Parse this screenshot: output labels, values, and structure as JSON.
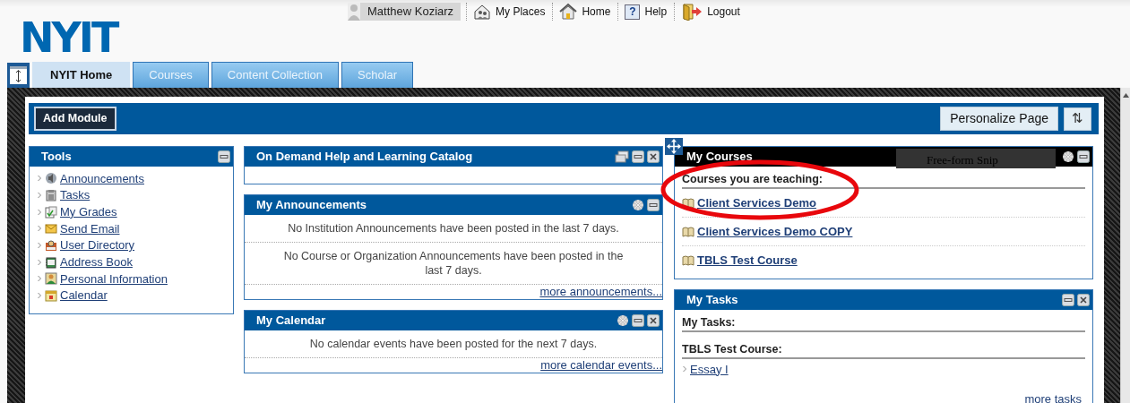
{
  "user": {
    "name": "Matthew Koziarz"
  },
  "top_links": [
    {
      "label": "My Places"
    },
    {
      "label": "Home"
    },
    {
      "label": "Help",
      "glyph": "?"
    },
    {
      "label": "Logout"
    }
  ],
  "logo": "NYIT",
  "tabs": [
    {
      "label": "NYIT Home",
      "selected": true
    },
    {
      "label": "Courses",
      "selected": false
    },
    {
      "label": "Content Collection",
      "selected": false
    },
    {
      "label": "Scholar",
      "selected": false
    }
  ],
  "toolbar": {
    "add_module": "Add Module",
    "personalize": "Personalize Page",
    "reorder": "⇅"
  },
  "columns": [
    [
      {
        "title": "Tools",
        "kind": "links",
        "highlighted": false,
        "configurable": false,
        "detachable": false,
        "closable": false,
        "items": [
          {
            "label": "Announcements"
          },
          {
            "label": "Tasks"
          },
          {
            "label": "My Grades"
          },
          {
            "label": "Send Email"
          },
          {
            "label": "User Directory"
          },
          {
            "label": "Address Book"
          },
          {
            "label": "Personal Information"
          },
          {
            "label": "Calendar"
          }
        ]
      }
    ],
    [
      {
        "title": "On Demand Help and Learning Catalog",
        "kind": "empty",
        "highlighted": false,
        "configurable": false,
        "detachable": true,
        "closable": true
      },
      {
        "title": "My Announcements",
        "kind": "messages",
        "highlighted": false,
        "configurable": true,
        "detachable": false,
        "closable": false,
        "messages": [
          "No Institution Announcements have been posted in the last 7 days.",
          "No Course or Organization Announcements have been posted in the last 7 days."
        ],
        "more": "more announcements..."
      },
      {
        "title": "My Calendar",
        "kind": "messages",
        "highlighted": false,
        "configurable": true,
        "detachable": false,
        "closable": true,
        "messages": [
          "No calendar events have been posted for the next 7 days."
        ],
        "more": "more calendar events..."
      }
    ],
    [
      {
        "title": "My Courses",
        "kind": "courses",
        "highlighted": true,
        "configurable": true,
        "detachable": false,
        "closable": false,
        "heading": "Courses you are teaching:",
        "items": [
          "Client Services Demo",
          "Client Services Demo COPY",
          "TBLS Test Course"
        ]
      },
      {
        "title": "My Tasks",
        "kind": "tasks",
        "highlighted": false,
        "configurable": false,
        "detachable": false,
        "closable": true,
        "sections": [
          {
            "heading": "My Tasks:"
          },
          {
            "heading": "TBLS Test Course:",
            "items": [
              "Essay I"
            ]
          }
        ],
        "more": "more tasks"
      }
    ]
  ],
  "overlays": {
    "snip_tooltip": "Free-form Snip"
  }
}
